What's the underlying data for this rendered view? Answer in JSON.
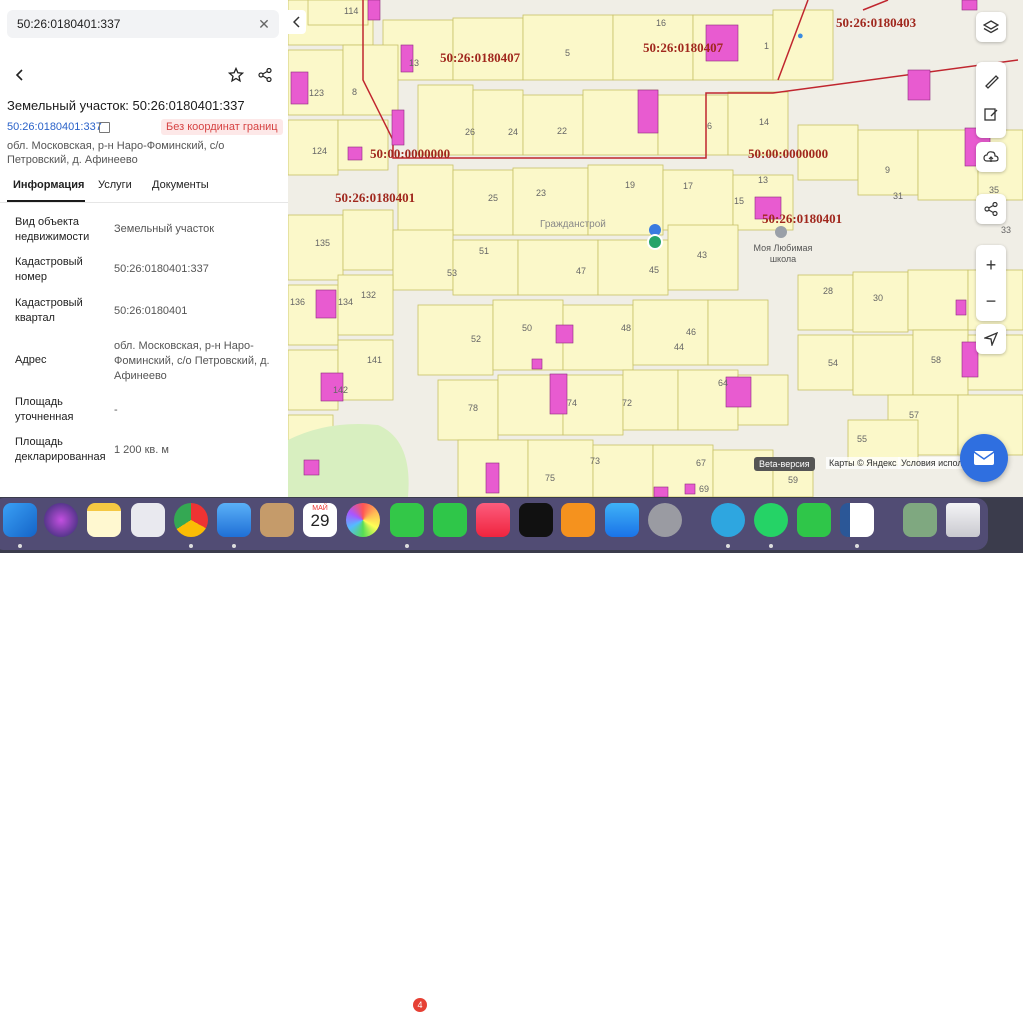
{
  "search": {
    "query": "50:26:0180401:337"
  },
  "object": {
    "title": "Земельный участок: 50:26:0180401:337",
    "cad_number": "50:26:0180401:337",
    "badge": "Без координат границ",
    "address": "обл. Московская, р-н Наро-Фоминский, с/о Петровский, д. Афинеево"
  },
  "tabs": [
    {
      "label": "Информация",
      "active": true
    },
    {
      "label": "Услуги",
      "active": false
    },
    {
      "label": "Документы",
      "active": false
    }
  ],
  "rows": [
    {
      "key": "Вид объекта недвижимости",
      "value": "Земельный участок"
    },
    {
      "key": "Кадастровый номер",
      "value": "50:26:0180401:337"
    },
    {
      "key": "Кадастровый квартал",
      "value": "50:26:0180401"
    },
    {
      "key": "Адрес",
      "value": "обл. Московская, р-н Наро-Фоминский, с/о Петровский, д. Афинеево"
    },
    {
      "key": "Площадь уточненная",
      "value": "-"
    },
    {
      "key": "Площадь декларированная",
      "value": "1 200 кв. м"
    }
  ],
  "map": {
    "quarter_labels": [
      "50:26:0180407",
      "50:26:0180407",
      "50:26:0180403",
      "50:00:0000000",
      "50:00:0000000",
      "50:26:0180401",
      "50:26:0180401"
    ],
    "street": "Гражданстрой",
    "poi": "Моя Любимая школа",
    "parcel_numbers": [
      "114",
      "16",
      "13",
      "5",
      "1",
      "123",
      "8",
      "124",
      "26",
      "24",
      "22",
      "6",
      "14",
      "25",
      "23",
      "19",
      "17",
      "13",
      "15",
      "9",
      "31",
      "35",
      "33",
      "135",
      "51",
      "53",
      "47",
      "45",
      "43",
      "28",
      "30",
      "136",
      "134",
      "132",
      "50",
      "48",
      "52",
      "46",
      "44",
      "54",
      "58",
      "141",
      "74",
      "72",
      "64",
      "142",
      "78",
      "57",
      "55",
      "75",
      "73",
      "69",
      "67",
      "59"
    ],
    "beta": "Beta-версия",
    "attribution": "Карты © Яндекс",
    "terms": "Условия испол"
  },
  "dock": {
    "calendar_month": "МАЙ",
    "calendar_day": "29",
    "messages_badge": "4"
  },
  "colors": {
    "parcel": "#fbf8c9",
    "building": "#e85bd0",
    "boundary": "#c0262f",
    "link": "#2a62c9",
    "badge_bg": "#fde8e8",
    "badge_text": "#d64343"
  }
}
